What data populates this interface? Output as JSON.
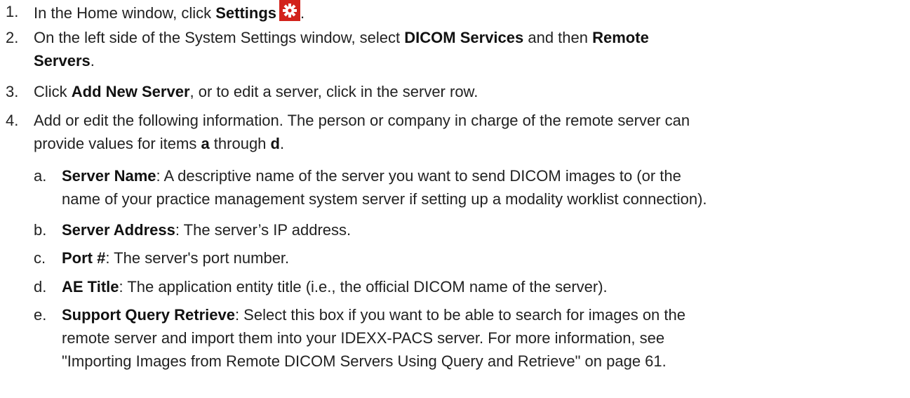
{
  "steps": [
    {
      "num": "1.",
      "pre": "In the Home window, click ",
      "bold1": "Settings",
      "post": "."
    },
    {
      "num": "2.",
      "pre": "On the left side of the System Settings window, select ",
      "bold1": "DICOM Services",
      "mid": " and then ",
      "bold2a": "Remote",
      "bold2b": "Servers",
      "post": "."
    },
    {
      "num": "3.",
      "pre": "Click ",
      "bold1": "Add New Server",
      "post": ", or to edit a server, click in the server row."
    },
    {
      "num": "4.",
      "line1": "Add or edit the following information. The person or company in charge of the remote server can",
      "line2pre": "provide values for items ",
      "bolda": "a",
      "line2mid": " through ",
      "boldd": "d",
      "line2post": "."
    }
  ],
  "substeps": [
    {
      "num": "a.",
      "bold": "Server Name",
      "line1": ": A descriptive name of the server you want to send DICOM images to (or the",
      "line2": "name of your practice management system server if setting up a modality worklist connection)."
    },
    {
      "num": "b.",
      "bold": "Server Address",
      "line1": ": The server’s IP address."
    },
    {
      "num": "c.",
      "bold": "Port #",
      "line1": ": The server's port number."
    },
    {
      "num": "d.",
      "bold": "AE Title",
      "line1": ": The application entity title (i.e., the official DICOM name of the server)."
    },
    {
      "num": "e.",
      "bold": "Support Query Retrieve",
      "line1": ": Select this box if you want to be able to search for images on the",
      "line2": "remote server and import them into your IDEXX-PACS server. For more information, see",
      "line3": "\"Importing Images from Remote DICOM Servers Using Query and Retrieve\" on page 61."
    }
  ],
  "icons": {
    "settings": "gear-icon"
  },
  "colors": {
    "gear_bg": "#d2231c",
    "text": "#222222"
  }
}
